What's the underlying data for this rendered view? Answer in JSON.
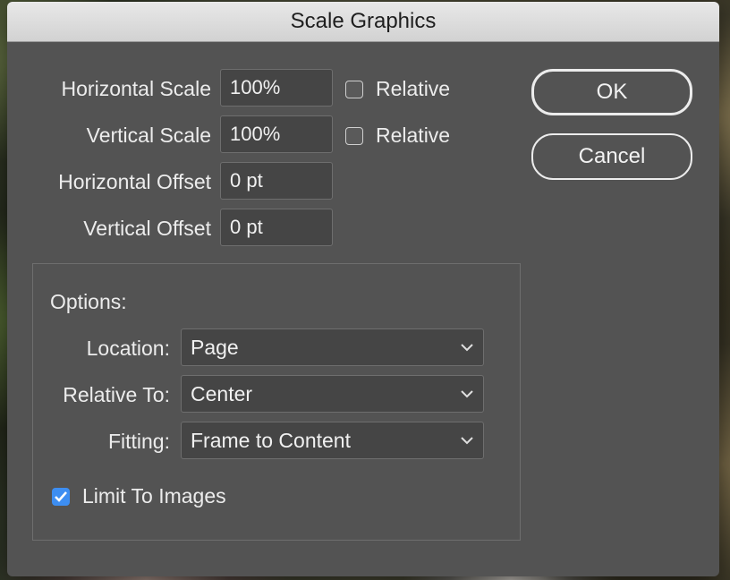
{
  "dialog": {
    "title": "Scale Graphics",
    "fields": [
      {
        "label": "Horizontal Scale",
        "value": "100%",
        "relative_label": "Relative",
        "relative_checked": false
      },
      {
        "label": "Vertical Scale",
        "value": "100%",
        "relative_label": "Relative",
        "relative_checked": false
      },
      {
        "label": "Horizontal Offset",
        "value": "0 pt"
      },
      {
        "label": "Vertical Offset",
        "value": "0 pt"
      }
    ],
    "buttons": {
      "ok": "OK",
      "cancel": "Cancel"
    },
    "options": {
      "heading": "Options:",
      "location": {
        "label": "Location:",
        "value": "Page"
      },
      "relative_to": {
        "label": "Relative To:",
        "value": "Center"
      },
      "fitting": {
        "label": "Fitting:",
        "value": "Frame to Content"
      },
      "limit_to_images": {
        "label": "Limit To Images",
        "checked": true
      }
    }
  },
  "colors": {
    "dialog_bg": "#535353",
    "field_bg": "#454545",
    "accent": "#3d8ef2",
    "text": "#ececec"
  }
}
